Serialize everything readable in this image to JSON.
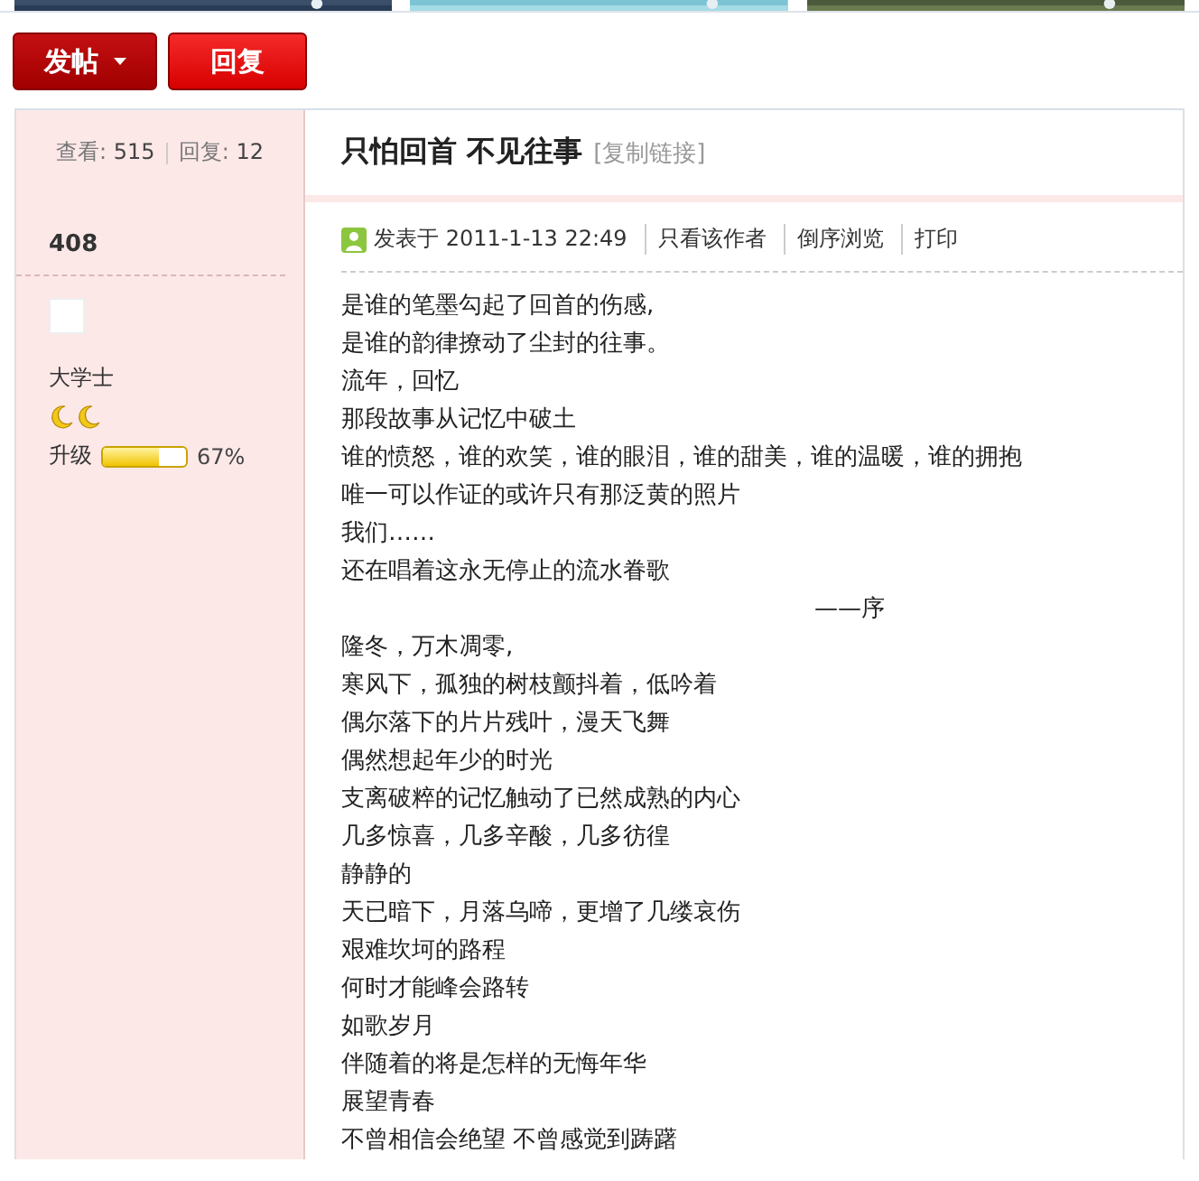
{
  "buttons": [
    {
      "label": "发帖",
      "caret": true,
      "kind": "dark"
    },
    {
      "label": "回复",
      "caret": false,
      "kind": "bright"
    }
  ],
  "stats": [
    {
      "label": "查看:",
      "value": "515"
    },
    {
      "label": "回复:",
      "value": "12"
    }
  ],
  "thread": {
    "title": "只怕回首 不见往事",
    "copy_link": "[复制链接]"
  },
  "author": {
    "name": "408",
    "rank": "大学士",
    "moons": [
      {
        "kind": "moon"
      },
      {
        "kind": "moon"
      }
    ],
    "level_label": "升级",
    "level": 0.67,
    "percent": "67%"
  },
  "post": {
    "posted": "发表于 2011-1-13 22:49",
    "actions": [
      "只看该作者",
      "倒序浏览",
      "打印"
    ],
    "lines": [
      {
        "text": "是谁的笔墨勾起了回首的伤感,",
        "kind": "verse"
      },
      {
        "text": "是谁的韵律撩动了尘封的往事。",
        "kind": "verse"
      },
      {
        "text": "流年，回忆",
        "kind": "verse"
      },
      {
        "text": "那段故事从记忆中破土",
        "kind": "verse"
      },
      {
        "text": "谁的愤怒，谁的欢笑，谁的眼泪，谁的甜美，谁的温暖，谁的拥抱",
        "kind": "verse"
      },
      {
        "text": "唯一可以作证的或许只有那泛黄的照片",
        "kind": "verse"
      },
      {
        "text": "我们……",
        "kind": "verse"
      },
      {
        "text": "还在唱着这永无停止的流水眷歌",
        "kind": "verse"
      },
      {
        "text": "——序",
        "kind": "attribution"
      },
      {
        "text": "隆冬，万木凋零,",
        "kind": "verse"
      },
      {
        "text": "寒风下，孤独的树枝颤抖着，低吟着",
        "kind": "verse"
      },
      {
        "text": "偶尔落下的片片残叶，漫天飞舞",
        "kind": "verse"
      },
      {
        "text": "偶然想起年少的时光",
        "kind": "verse"
      },
      {
        "text": "支离破粹的记忆触动了已然成熟的内心",
        "kind": "verse"
      },
      {
        "text": "几多惊喜，几多辛酸，几多彷徨",
        "kind": "verse"
      },
      {
        "text": "静静的",
        "kind": "verse"
      },
      {
        "text": "天已暗下，月落乌啼，更增了几缕哀伤",
        "kind": "verse"
      },
      {
        "text": "艰难坎坷的路程",
        "kind": "verse"
      },
      {
        "text": "何时才能峰会路转",
        "kind": "verse"
      },
      {
        "text": "如歌岁月",
        "kind": "verse"
      },
      {
        "text": "伴随着的将是怎样的无悔年华",
        "kind": "verse"
      },
      {
        "text": "展望青春",
        "kind": "verse"
      },
      {
        "text": "不曾相信会绝望 不曾感觉到踌躇",
        "kind": "verse"
      }
    ]
  }
}
